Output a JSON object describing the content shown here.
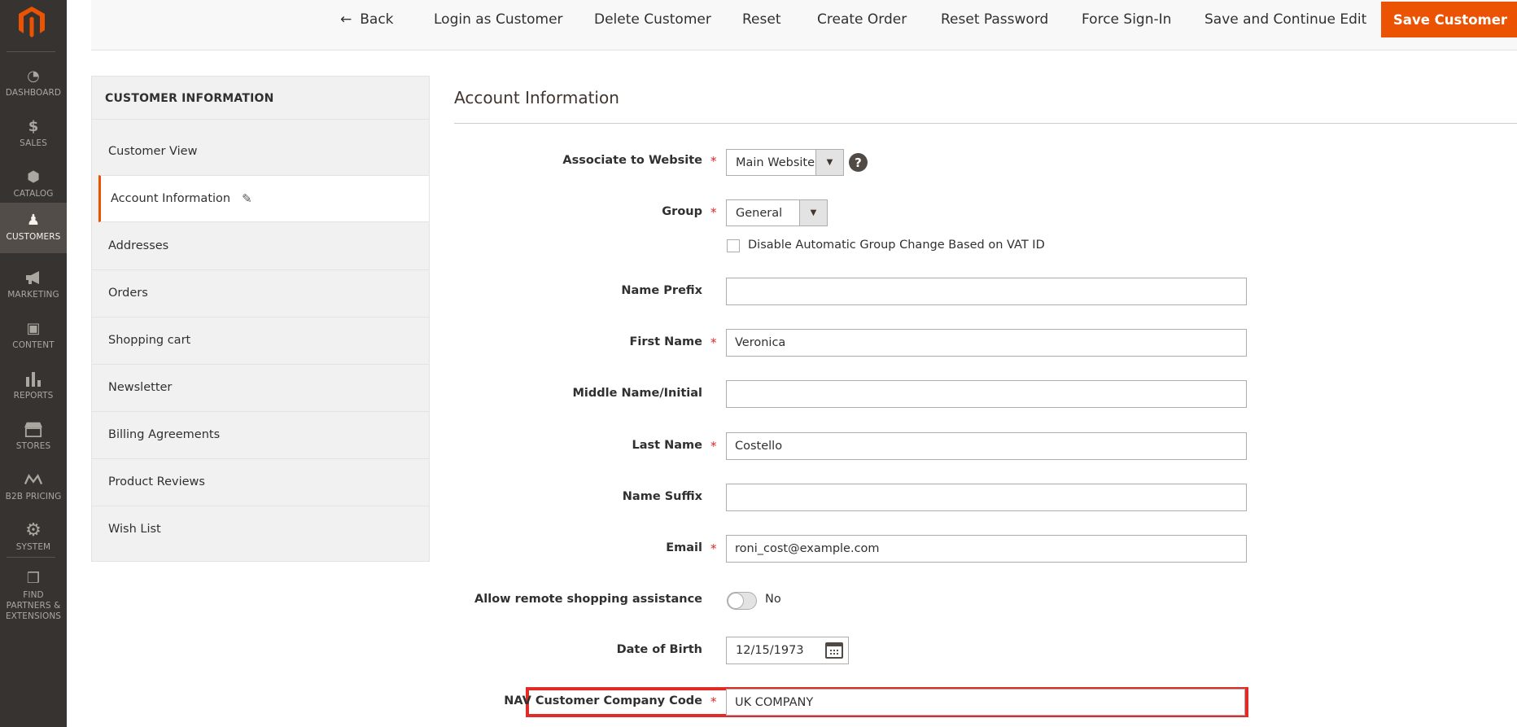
{
  "admin_nav": {
    "items": [
      {
        "label": "DASHBOARD",
        "icon": "dashboard-icon",
        "glyph": "◔"
      },
      {
        "label": "SALES",
        "icon": "dollar-icon",
        "glyph": "$"
      },
      {
        "label": "CATALOG",
        "icon": "cube-icon",
        "glyph": "⬢"
      },
      {
        "label": "CUSTOMERS",
        "icon": "person-icon",
        "glyph": "♟"
      },
      {
        "label": "MARKETING",
        "icon": "megaphone-icon",
        "glyph": "📢"
      },
      {
        "label": "CONTENT",
        "icon": "layout-icon",
        "glyph": "▣"
      },
      {
        "label": "REPORTS",
        "icon": "bar-chart-icon",
        "glyph": "▮"
      },
      {
        "label": "STORES",
        "icon": "storefront-icon",
        "glyph": "⌂"
      },
      {
        "label": "B2B PRICING",
        "icon": "b2b-icon",
        "glyph": "⋈"
      },
      {
        "label": "SYSTEM",
        "icon": "gear-icon",
        "glyph": "⚙"
      },
      {
        "label": "FIND PARTNERS & EXTENSIONS",
        "icon": "boxes-icon",
        "glyph": "❒"
      }
    ],
    "active": "CUSTOMERS"
  },
  "actions": {
    "back": "Back",
    "back_glyph": "←",
    "login_as_customer": "Login as Customer",
    "delete_customer": "Delete Customer",
    "reset": "Reset",
    "create_order": "Create Order",
    "reset_password": "Reset Password",
    "force_sign_in": "Force Sign-In",
    "save_and_continue": "Save and Continue Edit",
    "save_customer": "Save Customer"
  },
  "tabs": {
    "title": "CUSTOMER INFORMATION",
    "items": [
      "Customer View",
      "Account Information",
      "Addresses",
      "Orders",
      "Shopping cart",
      "Newsletter",
      "Billing Agreements",
      "Product Reviews",
      "Wish List"
    ],
    "active": "Account Information",
    "edit_glyph": "✎"
  },
  "form": {
    "section_title": "Account Information",
    "associate_to_website": {
      "label": "Associate to Website",
      "value": "Main Website"
    },
    "group": {
      "label": "Group",
      "value": "General"
    },
    "disable_group_change": {
      "label": "Disable Automatic Group Change Based on VAT ID",
      "checked": false
    },
    "name_prefix": {
      "label": "Name Prefix",
      "value": ""
    },
    "first_name": {
      "label": "First Name",
      "value": "Veronica"
    },
    "middle_name": {
      "label": "Middle Name/Initial",
      "value": ""
    },
    "last_name": {
      "label": "Last Name",
      "value": "Costello"
    },
    "name_suffix": {
      "label": "Name Suffix",
      "value": ""
    },
    "email": {
      "label": "Email",
      "value": "roni_cost@example.com"
    },
    "remote_assistance": {
      "label": "Allow remote shopping assistance",
      "value": "No"
    },
    "date_of_birth": {
      "label": "Date of Birth",
      "value": "12/15/1973"
    },
    "nav_company_code": {
      "label": "NAV Customer Company Code",
      "value": "UK COMPANY"
    },
    "required_mark": "*",
    "help_glyph": "?",
    "dropdown_glyph": "▼"
  },
  "colors": {
    "accent": "#eb5202",
    "nav_bg": "#373330",
    "required": "#e22626",
    "highlight": "#e02b27"
  }
}
